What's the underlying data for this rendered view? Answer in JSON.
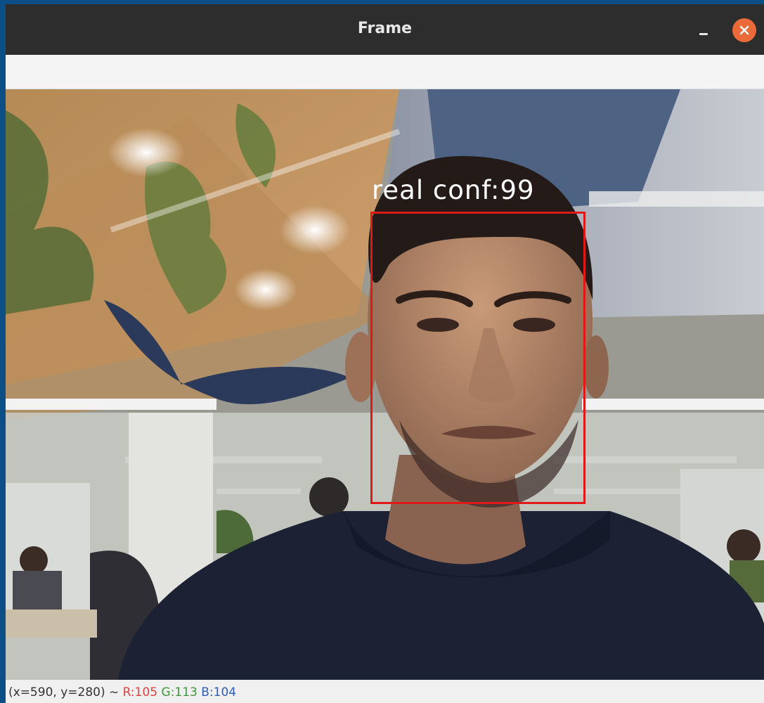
{
  "window": {
    "title": "Frame",
    "minimize_icon": "minimize-icon",
    "close_icon": "close-icon"
  },
  "detection": {
    "label": "real conf:99",
    "box_color": "#e01818"
  },
  "status": {
    "position": "(x=590, y=280) ~",
    "r": "R:105",
    "g": "G:113",
    "b": "B:104"
  },
  "colors": {
    "titlebar": "#2d2d2d",
    "close_button": "#ea6a3a",
    "frame_border": "#0b4f86"
  }
}
